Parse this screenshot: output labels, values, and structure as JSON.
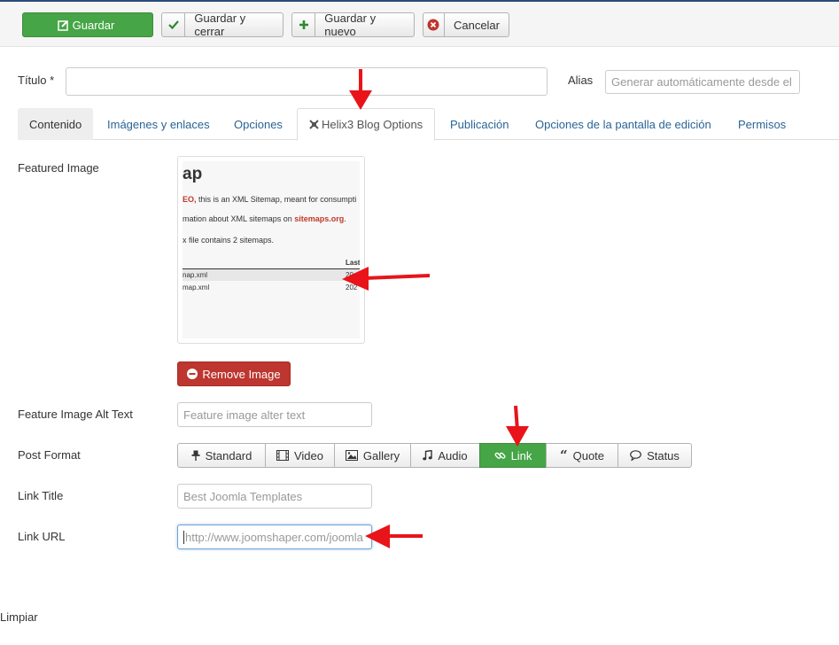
{
  "toolbar": {
    "save": "Guardar",
    "save_close": "Guardar y cerrar",
    "save_new": "Guardar y nuevo",
    "cancel": "Cancelar"
  },
  "form": {
    "title_label": "Título *",
    "alias_label": "Alias",
    "alias_placeholder": "Generar automáticamente desde el"
  },
  "tabs": [
    "Contenido",
    "Imágenes y enlaces",
    "Opciones",
    "Helix3 Blog Options",
    "Publicación",
    "Opciones de la pantalla de edición",
    "Permisos"
  ],
  "active_tab": "Helix3 Blog Options",
  "featured": {
    "label": "Featured Image",
    "thumb_heading": "ap",
    "thumb_line1_a": "EO,",
    "thumb_line1_b": " this is an XML Sitemap, meant for consumpti",
    "thumb_line2_a": "mation about XML sitemaps on ",
    "thumb_line2_b": "sitemaps.org",
    "thumb_line3": "x file contains 2 sitemaps.",
    "thumb_col": "Last",
    "thumb_row1": "nap.xml",
    "thumb_row1_val": "20",
    "thumb_row2": "map.xml",
    "thumb_row2_val": "202",
    "remove_label": "Remove Image"
  },
  "alt_text": {
    "label": "Feature Image Alt Text",
    "placeholder": "Feature image alter text"
  },
  "post_format": {
    "label": "Post Format",
    "options": [
      "Standard",
      "Video",
      "Gallery",
      "Audio",
      "Link",
      "Quote",
      "Status"
    ],
    "selected": "Link"
  },
  "link_title": {
    "label": "Link Title",
    "placeholder": "Best Joomla Templates"
  },
  "link_url": {
    "label": "Link URL",
    "placeholder": "http://www.joomshaper.com/joomla"
  },
  "clear_label": "Limpiar",
  "colors": {
    "green": "#46a546",
    "red_button": "#bd362f",
    "link_blue": "#2a6496",
    "arrow_red": "#e8141a"
  }
}
